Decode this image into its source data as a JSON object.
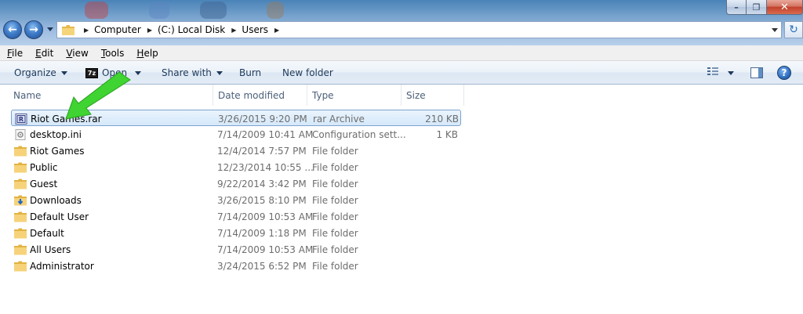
{
  "window": {
    "minimize_label": "–",
    "maximize_label": "❐",
    "close_label": "✕"
  },
  "nav": {
    "back_label": "←",
    "forward_label": "→"
  },
  "address": {
    "crumbs": [
      "Computer",
      "(C:) Local Disk",
      "Users"
    ],
    "separator": "▶"
  },
  "refresh_label": "↻",
  "menu": {
    "items": [
      {
        "label": "File",
        "key": "F",
        "rest": "ile"
      },
      {
        "label": "Edit",
        "key": "E",
        "rest": "dit"
      },
      {
        "label": "View",
        "key": "V",
        "rest": "iew"
      },
      {
        "label": "Tools",
        "key": "T",
        "rest": "ools"
      },
      {
        "label": "Help",
        "key": "H",
        "rest": "elp"
      }
    ]
  },
  "toolbar": {
    "organize": "Organize",
    "open_icon_text": "7z",
    "open": "Open",
    "share_with": "Share with",
    "burn": "Burn",
    "new_folder": "New folder",
    "help_icon_text": "?"
  },
  "columns": {
    "name": "Name",
    "date_modified": "Date modified",
    "type": "Type",
    "size": "Size"
  },
  "files": [
    {
      "name": "Riot Games.rar",
      "date": "3/26/2015 9:20 PM",
      "type": "rar Archive",
      "size": "210 KB",
      "icon": "rar-archive-icon",
      "selected": true
    },
    {
      "name": "desktop.ini",
      "date": "7/14/2009 10:41 AM",
      "type": "Configuration sett...",
      "size": "1 KB",
      "icon": "settings-file-icon",
      "selected": false
    },
    {
      "name": "Riot Games",
      "date": "12/4/2014 7:57 PM",
      "type": "File folder",
      "size": "",
      "icon": "folder-icon",
      "selected": false
    },
    {
      "name": "Public",
      "date": "12/23/2014 10:55 ...",
      "type": "File folder",
      "size": "",
      "icon": "folder-icon",
      "selected": false
    },
    {
      "name": "Guest",
      "date": "9/22/2014 3:42 PM",
      "type": "File folder",
      "size": "",
      "icon": "folder-icon",
      "selected": false
    },
    {
      "name": "Downloads",
      "date": "3/26/2015 8:10 PM",
      "type": "File folder",
      "size": "",
      "icon": "downloads-folder-icon",
      "selected": false
    },
    {
      "name": "Default User",
      "date": "7/14/2009 10:53 AM",
      "type": "File folder",
      "size": "",
      "icon": "folder-icon",
      "selected": false
    },
    {
      "name": "Default",
      "date": "7/14/2009 1:18 PM",
      "type": "File folder",
      "size": "",
      "icon": "folder-icon",
      "selected": false
    },
    {
      "name": "All Users",
      "date": "7/14/2009 10:53 AM",
      "type": "File folder",
      "size": "",
      "icon": "folder-icon",
      "selected": false
    },
    {
      "name": "Administrator",
      "date": "3/24/2015 6:52 PM",
      "type": "File folder",
      "size": "",
      "icon": "folder-icon",
      "selected": false
    }
  ],
  "colors": {
    "accent": "#1e395b",
    "selection": "#d5e8fa",
    "annotation_arrow": "#3fd431"
  }
}
